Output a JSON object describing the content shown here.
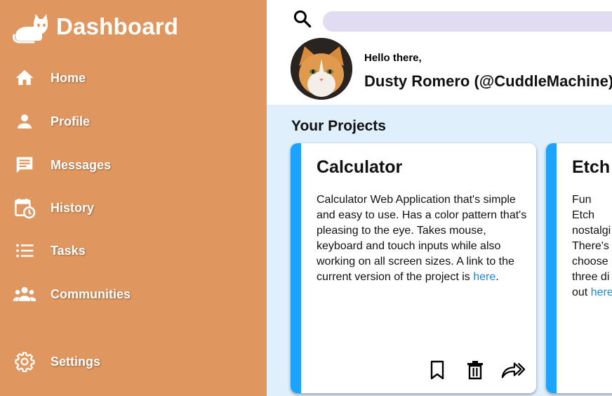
{
  "brand": {
    "title": "Dashboard",
    "logo_icon": "cat-icon"
  },
  "sidebar": {
    "items": [
      {
        "label": "Home",
        "icon": "home-icon"
      },
      {
        "label": "Profile",
        "icon": "person-icon"
      },
      {
        "label": "Messages",
        "icon": "message-icon"
      },
      {
        "label": "History",
        "icon": "calendar-clock-icon"
      },
      {
        "label": "Tasks",
        "icon": "list-icon"
      },
      {
        "label": "Communities",
        "icon": "group-icon"
      },
      {
        "label": "Settings",
        "icon": "gear-icon"
      }
    ]
  },
  "header": {
    "search": {
      "placeholder": "",
      "value": ""
    },
    "greeting": "Hello there,",
    "username": "Dusty Romero (@CuddleMachine)"
  },
  "main": {
    "section_title": "Your Projects",
    "projects": [
      {
        "title": "Calculator",
        "description": "Calculator Web Application that's simple and easy to use. Has a color pattern that's pleasing to the eye. Takes mouse, keyboard and touch inputs while also working on all screen sizes. A link to the current version of the project is",
        "link_text": "here",
        "suffix": "."
      },
      {
        "title": "Etch A",
        "description": "Fun Etch nostalgi There's choose three di out",
        "link_text": "here",
        "suffix": ""
      }
    ]
  },
  "colors": {
    "sidebar_bg": "#e0965f",
    "main_bg": "#dfeffb",
    "accent": "#1aa3ff",
    "search_bg": "#e2dcf2",
    "link": "#1a88d8"
  }
}
